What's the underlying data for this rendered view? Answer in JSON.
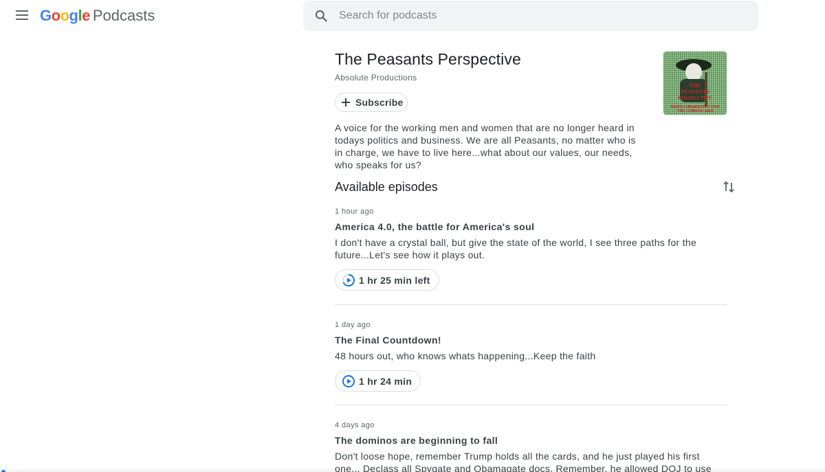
{
  "header": {
    "menu_icon": "hamburger-menu-icon",
    "logo_letters": [
      {
        "char": "G",
        "color": "#4285F4"
      },
      {
        "char": "o",
        "color": "#EA4335"
      },
      {
        "char": "o",
        "color": "#FBBC05"
      },
      {
        "char": "g",
        "color": "#4285F4"
      },
      {
        "char": "l",
        "color": "#34A853"
      },
      {
        "char": "e",
        "color": "#EA4335"
      }
    ],
    "logo_product": "Podcasts",
    "search": {
      "placeholder": "Search for podcasts",
      "value": "",
      "icon": "search-icon"
    }
  },
  "show": {
    "title": "The Peasants Perspective",
    "publisher": "Absolute Productions",
    "subscribe_label": "Subscribe",
    "cover_art_text": [
      "THE",
      "PEASANTS",
      "PERSPECTIVE",
      "NEWS COMMENTARY FOR",
      "THE COMMON MAN"
    ],
    "description": "A voice for the working men and women that are no longer heard in todays politics and business. We are all Peasants, no matter who is in charge, we have to live here...what about our values, our needs, who speaks for us?"
  },
  "episodes_section": {
    "title": "Available episodes",
    "sort_icon": "sort-arrows-icon"
  },
  "episodes": [
    {
      "date": "1 hour ago",
      "title": "America 4.0, the battle for America's soul",
      "description": "I don't have a crystal ball, but give the state of the world, I see three paths for the future...Let's see how it plays out.",
      "duration": "1 hr 25 min left"
    },
    {
      "date": "1 day ago",
      "title": "The Final Countdown!",
      "description": "48 hours out, who knows whats happening...Keep the faith",
      "duration": "1 hr 24 min"
    },
    {
      "date": "4 days ago",
      "title": "The dominos are beginning to fall",
      "description": "Don't loose hope, remember Trump holds all the cards, and he just played his first one... Declass all Spygate and Obamagate docs.  Remember, he allowed DOJ to use classified docs for…",
      "duration": ""
    }
  ],
  "colors": {
    "accent_blue": "#1a73e8",
    "text_primary": "#202124",
    "text_secondary": "#5f6368",
    "divider": "#dadce0",
    "search_bg": "#f1f3f4"
  }
}
